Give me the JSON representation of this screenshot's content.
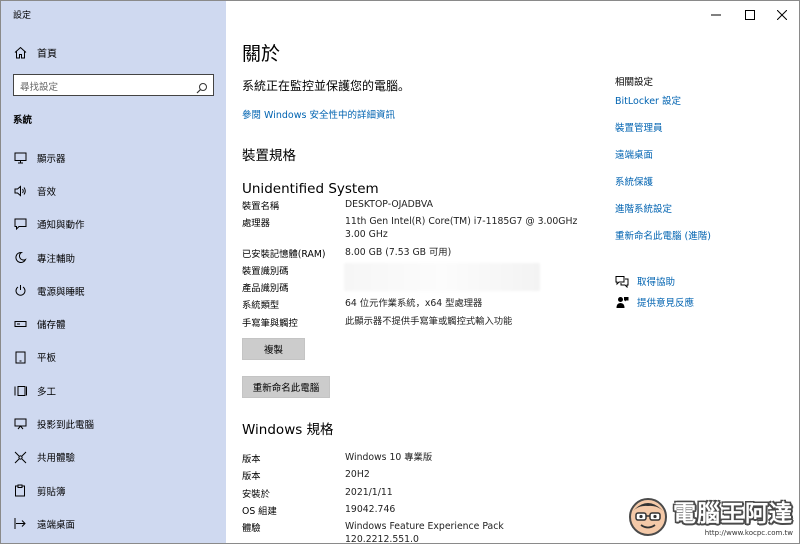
{
  "app": {
    "title": "設定"
  },
  "window_controls": {
    "minimize": "—",
    "maximize": "☐",
    "close": "✕"
  },
  "sidebar": {
    "home_label": "首頁",
    "search_placeholder": "尋找設定",
    "section_label": "系統",
    "items": [
      {
        "label": "顯示器",
        "icon": "monitor-icon"
      },
      {
        "label": "音效",
        "icon": "speaker-icon"
      },
      {
        "label": "通知與動作",
        "icon": "notification-icon"
      },
      {
        "label": "專注輔助",
        "icon": "moon-icon"
      },
      {
        "label": "電源與睡眠",
        "icon": "power-icon"
      },
      {
        "label": "儲存體",
        "icon": "storage-icon"
      },
      {
        "label": "平板",
        "icon": "tablet-icon"
      },
      {
        "label": "多工",
        "icon": "multitask-icon"
      },
      {
        "label": "投影到此電腦",
        "icon": "project-icon"
      },
      {
        "label": "共用體驗",
        "icon": "share-icon"
      },
      {
        "label": "剪貼簿",
        "icon": "clipboard-icon"
      },
      {
        "label": "遠端桌面",
        "icon": "remote-icon"
      }
    ]
  },
  "main": {
    "title": "關於",
    "protection_text": "系統正在監控並保護您的電腦。",
    "protection_link": "參閱 Windows 安全性中的詳細資訊",
    "device_spec_heading": "裝置規格",
    "device_name_big": "Unidentified System",
    "device_specs": [
      {
        "key": "裝置名稱",
        "value": "DESKTOP-OJADBVA"
      },
      {
        "key": "處理器",
        "value": "11th Gen Intel(R) Core(TM) i7-1185G7 @ 3.00GHz 3.00 GHz"
      },
      {
        "key": "已安裝記憶體(RAM)",
        "value": "8.00 GB (7.53 GB 可用)"
      },
      {
        "key": "裝置識別碼",
        "value": ""
      },
      {
        "key": "產品識別碼",
        "value": ""
      },
      {
        "key": "系統類型",
        "value": "64 位元作業系統，x64 型處理器"
      },
      {
        "key": "手寫筆與觸控",
        "value": "此顯示器不提供手寫筆或觸控式輸入功能"
      }
    ],
    "copy_button": "複製",
    "rename_button": "重新命名此電腦",
    "windows_spec_heading": "Windows 規格",
    "windows_specs": [
      {
        "key": "版本",
        "value": "Windows 10 專業版"
      },
      {
        "key": "版本",
        "value": "20H2"
      },
      {
        "key": "安裝於",
        "value": "2021/1/11"
      },
      {
        "key": "OS 組建",
        "value": "19042.746"
      },
      {
        "key": "體驗",
        "value": "Windows Feature Experience Pack 120.2212.551.0"
      }
    ]
  },
  "related": {
    "title": "相關設定",
    "links": [
      "BitLocker 設定",
      "裝置管理員",
      "遠端桌面",
      "系統保護",
      "進階系統設定",
      "重新命名此電腦 (進階)"
    ],
    "help": [
      {
        "label": "取得協助",
        "icon": "help-chat-icon"
      },
      {
        "label": "提供意見反應",
        "icon": "feedback-icon"
      }
    ]
  },
  "watermark": {
    "text": "電腦王阿達",
    "url": "http://www.kocpc.com.tw"
  },
  "colors": {
    "sidebar_bg": "#cfd9f0",
    "link": "#0063b1",
    "button_bg": "#cccccc"
  }
}
